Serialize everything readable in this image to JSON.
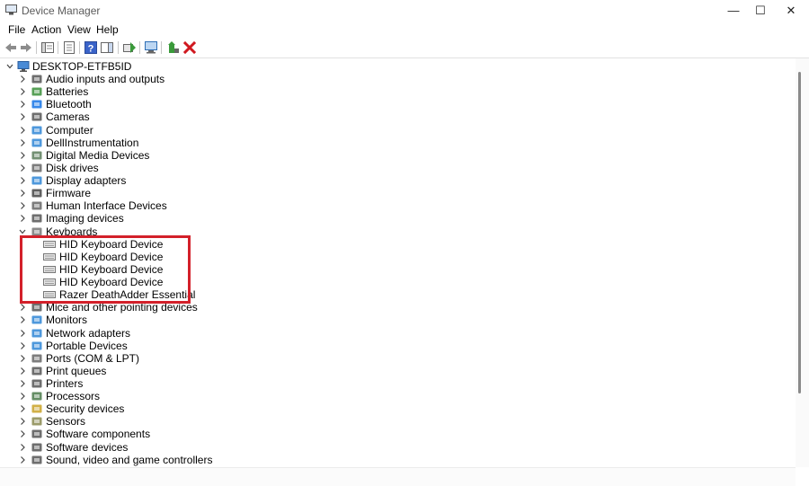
{
  "window": {
    "title": "Device Manager"
  },
  "window_controls": {
    "minimize": "—",
    "maximize": "☐",
    "close": "✕"
  },
  "menu": [
    "File",
    "Action",
    "View",
    "Help"
  ],
  "tree": {
    "root": "DESKTOP-ETFB5ID",
    "items": [
      {
        "label": "Audio inputs and outputs",
        "icon": "speaker-icon",
        "color": "#555555"
      },
      {
        "label": "Batteries",
        "icon": "battery-icon",
        "color": "#3a8f3a"
      },
      {
        "label": "Bluetooth",
        "icon": "bluetooth-icon",
        "color": "#1473e6"
      },
      {
        "label": "Cameras",
        "icon": "camera-icon",
        "color": "#555555"
      },
      {
        "label": "Computer",
        "icon": "computer-icon",
        "color": "#2f86d6"
      },
      {
        "label": "DellInstrumentation",
        "icon": "monitor-icon",
        "color": "#2f86d6"
      },
      {
        "label": "Digital Media Devices",
        "icon": "media-device-icon",
        "color": "#5a7d5a"
      },
      {
        "label": "Disk drives",
        "icon": "disk-drive-icon",
        "color": "#666666"
      },
      {
        "label": "Display adapters",
        "icon": "display-adapter-icon",
        "color": "#2f86d6"
      },
      {
        "label": "Firmware",
        "icon": "firmware-icon",
        "color": "#444444"
      },
      {
        "label": "Human Interface Devices",
        "icon": "hid-icon",
        "color": "#666666"
      },
      {
        "label": "Imaging devices",
        "icon": "imaging-icon",
        "color": "#555555"
      },
      {
        "label": "Keyboards",
        "icon": "keyboard-icon",
        "color": "#777777",
        "expanded": true,
        "children": [
          "HID Keyboard Device",
          "HID Keyboard Device",
          "HID Keyboard Device",
          "HID Keyboard Device",
          "Razer DeathAdder Essential"
        ]
      },
      {
        "label": "Mice and other pointing devices",
        "icon": "mouse-icon",
        "color": "#555555"
      },
      {
        "label": "Monitors",
        "icon": "monitor-icon",
        "color": "#2f86d6"
      },
      {
        "label": "Network adapters",
        "icon": "network-icon",
        "color": "#2f86d6"
      },
      {
        "label": "Portable Devices",
        "icon": "portable-device-icon",
        "color": "#2f86d6"
      },
      {
        "label": "Ports (COM & LPT)",
        "icon": "port-icon",
        "color": "#666666"
      },
      {
        "label": "Print queues",
        "icon": "print-queue-icon",
        "color": "#555555"
      },
      {
        "label": "Printers",
        "icon": "printer-icon",
        "color": "#555555"
      },
      {
        "label": "Processors",
        "icon": "processor-icon",
        "color": "#4a7a4a"
      },
      {
        "label": "Security devices",
        "icon": "security-icon",
        "color": "#c9a227"
      },
      {
        "label": "Sensors",
        "icon": "sensor-icon",
        "color": "#8a8a50"
      },
      {
        "label": "Software components",
        "icon": "software-component-icon",
        "color": "#555555"
      },
      {
        "label": "Software devices",
        "icon": "software-device-icon",
        "color": "#555555"
      },
      {
        "label": "Sound, video and game controllers",
        "icon": "sound-icon",
        "color": "#555555"
      }
    ]
  },
  "highlight_color": "#d3202a"
}
